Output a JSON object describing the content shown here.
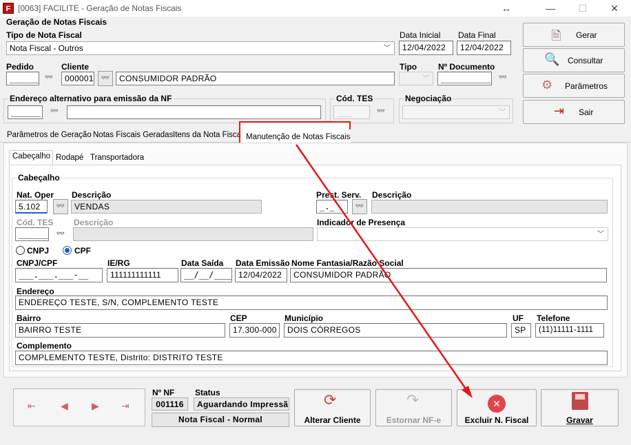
{
  "window": {
    "title": "[0063] FACILITE - Geração de Notas Fiscais",
    "minimize": "—",
    "restore": "☐",
    "close": "✕",
    "resize_icon": "↔"
  },
  "header": {
    "section_title": "Geração de Notas Fiscais",
    "tipo_nota_label": "Tipo de Nota Fiscal",
    "tipo_nota_value": "Nota Fiscal - Outros",
    "data_inicial_label": "Data Inicial",
    "data_inicial_value": "12/04/2022",
    "data_final_label": "Data Final",
    "data_final_value": "12/04/2022",
    "pedido_label": "Pedido",
    "pedido_value": "______",
    "cliente_label": "Cliente",
    "cliente_code": "000001",
    "cliente_name": "CONSUMIDOR PADRÃO",
    "tipo_label": "Tipo",
    "ndoc_label": "Nº Documento",
    "ndoc_value": "__________",
    "endereco_alt_label": "Endereço alternativo para emissão da NF",
    "endereco_alt_value": "______",
    "cod_tes_label": "Cód. TES",
    "cod_tes_value": "___",
    "negociacao_label": "Negociação"
  },
  "side_buttons": {
    "gerar": "Gerar",
    "consultar": "Consultar",
    "parametros": "Parâmetros",
    "sair": "Sair"
  },
  "tabs": [
    "Parâmetros de Geração",
    "Notas Fiscais Geradas",
    "Itens da Nota Fiscal",
    "Manutenção de Notas Fiscais"
  ],
  "subtabs": [
    "Cabeçalho",
    "Rodapé",
    "Transportadora"
  ],
  "cabecalho": {
    "group_title": "Cabeçalho",
    "nat_oper_label": "Nat. Oper",
    "nat_oper_value": "5.102",
    "descricao_label": "Descrição",
    "descricao_value": "VENDAS",
    "prest_serv_label": "Prest. Serv.",
    "prest_serv_value": "_._",
    "descricao2_label": "Descrição",
    "cod_tes_label": "Cód. TES",
    "cod_tes_value": "______",
    "descricao3_label": "Descrição",
    "indicador_label": "Indicador de Presença",
    "cnpj_radio": "CNPJ",
    "cpf_radio": "CPF",
    "cnpj_cpf_label": "CNPJ/CPF",
    "cnpj_cpf_value": "___.___.___-__",
    "ie_rg_label": "IE/RG",
    "ie_rg_value": "111111111111",
    "data_saida_label": "Data Saída",
    "data_saida_value": "__/__/____",
    "data_emissao_label": "Data Emissão",
    "data_emissao_value": "12/04/2022",
    "nome_fantasia_label": "Nome Fantasia/Razão Social",
    "nome_fantasia_value": "CONSUMIDOR PADRÃO",
    "endereco_label": "Endereço",
    "endereco_value": "ENDEREÇO TESTE, S/N, COMPLEMENTO TESTE",
    "bairro_label": "Bairro",
    "bairro_value": "BAIRRO TESTE",
    "cep_label": "CEP",
    "cep_value": "17.300-000",
    "municipio_label": "Município",
    "municipio_value": "DOIS CÓRREGOS",
    "uf_label": "UF",
    "uf_value": "SP",
    "telefone_label": "Telefone",
    "telefone_value": "(11)11111-1111",
    "complemento_label": "Complemento",
    "complemento_value": "COMPLEMENTO TESTE, Distrito: DISTRITO TESTE"
  },
  "footer": {
    "nav": [
      "⇤",
      "◀",
      "▶",
      "⇥"
    ],
    "nf_label": "Nº NF",
    "nf_value": "001116",
    "status_label": "Status",
    "status_value": "Aguardando Impressão",
    "tipo_nf": "Nota Fiscal - Normal",
    "alterar_cliente": "Alterar Cliente",
    "estornar": "Estornar NF-e",
    "excluir": "Excluir N. Fiscal",
    "gravar": "Gravar"
  },
  "colors": {
    "highlight": "#e8141a",
    "window_bg": "#f0f0f0"
  }
}
